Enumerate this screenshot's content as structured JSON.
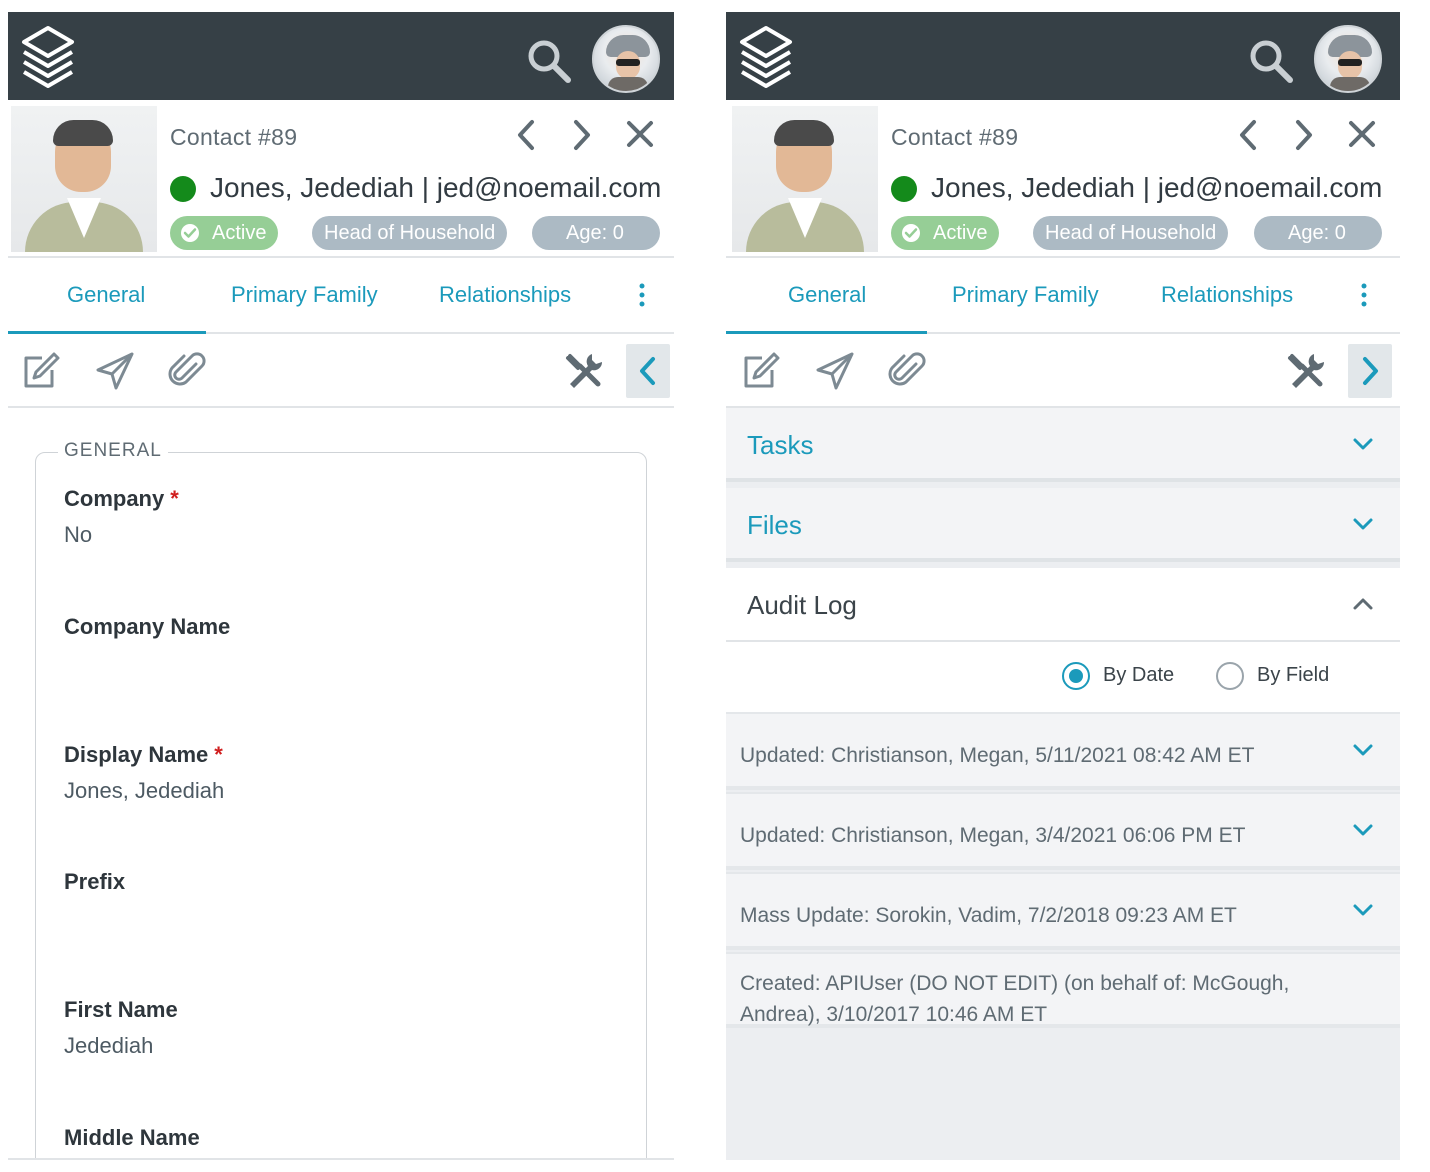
{
  "left": {
    "contact_number": "Contact #89",
    "contact_name": "Jones, Jedediah | jed@noemail.com",
    "pills": {
      "active": "Active",
      "household": "Head of Household",
      "age": "Age: 0"
    },
    "tabs": [
      "General",
      "Primary Family",
      "Relationships"
    ],
    "section_legend": "GENERAL",
    "fields": [
      {
        "label": "Company",
        "required": "*",
        "value": "No"
      },
      {
        "label": "Company Name",
        "required": "",
        "value": ""
      },
      {
        "label": "Display Name",
        "required": "*",
        "value": "Jones, Jedediah"
      },
      {
        "label": "Prefix",
        "required": "",
        "value": ""
      },
      {
        "label": "First Name",
        "required": "",
        "value": "Jedediah"
      },
      {
        "label": "Middle Name",
        "required": "",
        "value": ""
      }
    ]
  },
  "right": {
    "contact_number": "Contact #89",
    "contact_name": "Jones, Jedediah | jed@noemail.com",
    "pills": {
      "active": "Active",
      "household": "Head of Household",
      "age": "Age: 0"
    },
    "tabs": [
      "General",
      "Primary Family",
      "Relationships"
    ],
    "accordion": {
      "tasks": "Tasks",
      "files": "Files",
      "audit_log": "Audit Log"
    },
    "audit_mode": {
      "by_date": "By Date",
      "by_field": "By Field",
      "selected": "By Date"
    },
    "audit_entries": [
      "Updated: Christianson, Megan, 5/11/2021 08:42 AM ET",
      "Updated: Christianson, Megan, 3/4/2021 06:06 PM ET",
      "Mass Update: Sorokin, Vadim, 7/2/2018 09:23 AM ET",
      "Created: APIUser (DO NOT EDIT) (on behalf of: McGough, Andrea), 3/10/2017 10:46 AM ET"
    ]
  },
  "icons": {
    "logo": "layers-stack-icon",
    "search": "search-icon",
    "prev": "chevron-left-icon",
    "next": "chevron-right-icon",
    "close": "close-icon",
    "more": "kebab-menu-icon",
    "edit": "edit-icon",
    "send": "send-icon",
    "attach": "paperclip-icon",
    "tools": "tools-icon"
  },
  "colors": {
    "topbar": "#364046",
    "accent": "#1b9abb",
    "status_green": "#148a1b",
    "active_pill": "#96ce96",
    "grey_pill": "#acbac4",
    "required": "#d01f1f"
  }
}
